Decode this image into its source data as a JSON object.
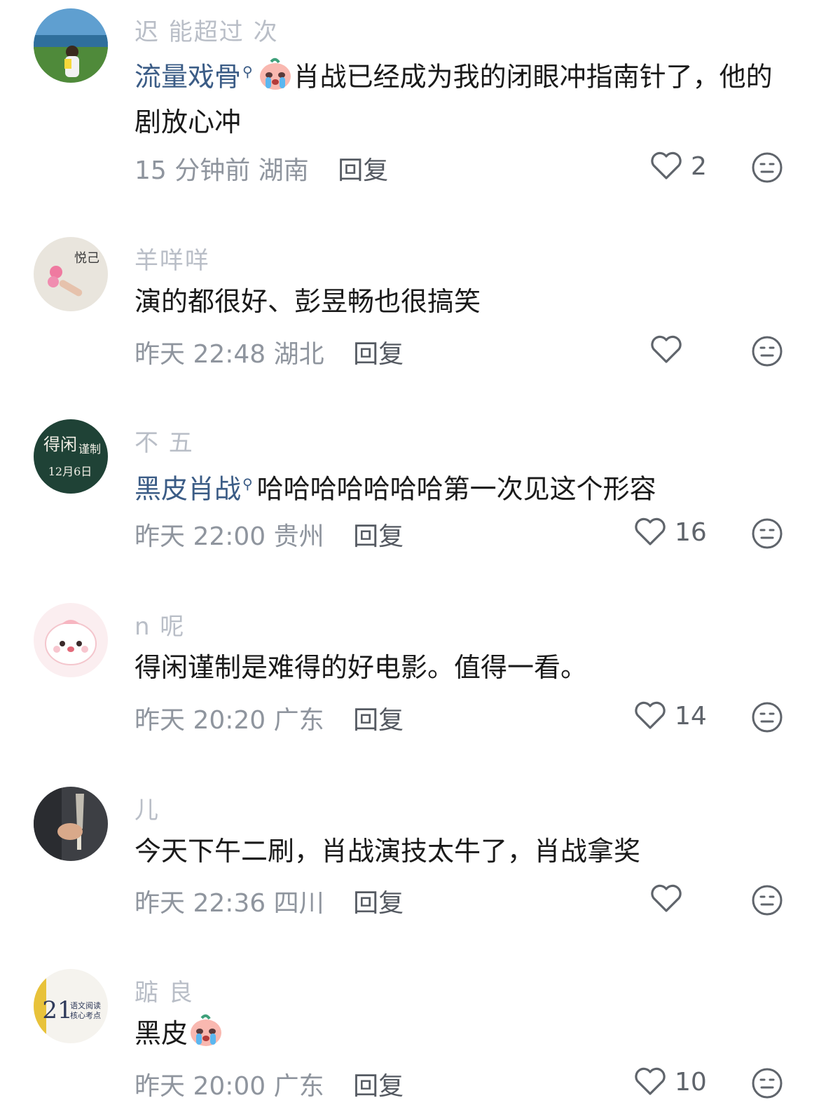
{
  "comments": [
    {
      "username": "迟 能超过 次",
      "mention": "流量戏骨",
      "text_before": "",
      "text_after": "肖战已经成为我的闭眼冲指南针了，他的剧放心冲",
      "has_emoji": true,
      "time": "15 分钟前",
      "location": "湖南",
      "reply_label": "回复",
      "likes": "2"
    },
    {
      "username": "羊咩咩",
      "mention": "",
      "text_before": "演的都很好、彭昱畅也很搞笑",
      "text_after": "",
      "has_emoji": false,
      "time": "昨天 22:48",
      "location": "湖北",
      "reply_label": "回复",
      "likes": ""
    },
    {
      "username": "不 五 ",
      "mention": "黑皮肖战",
      "text_before": "",
      "text_after": "哈哈哈哈哈哈哈第一次见这个形容",
      "has_emoji": false,
      "time": "昨天 22:00",
      "location": "贵州",
      "reply_label": "回复",
      "likes": "16"
    },
    {
      "username": "n 呢",
      "mention": "",
      "text_before": "得闲谨制是难得的好电影。值得一看。",
      "text_after": "",
      "has_emoji": false,
      "time": "昨天 20:20",
      "location": "广东",
      "reply_label": "回复",
      "likes": "14"
    },
    {
      "username": "  儿",
      "mention": "",
      "text_before": "今天下午二刷，肖战演技太牛了，肖战拿奖",
      "text_after": "",
      "has_emoji": false,
      "time": "昨天 22:36",
      "location": "四川",
      "reply_label": "回复",
      "likes": ""
    },
    {
      "username": "踮  良",
      "mention": "",
      "text_before": "黑皮",
      "text_after": "",
      "has_emoji": true,
      "time": "昨天 20:00",
      "location": "广东",
      "reply_label": "回复",
      "likes": "10"
    }
  ],
  "avatars": {
    "c3_line1": "得闲",
    "c3_line2": "谨制",
    "c3_date": "12月6日",
    "c2_sign": "悦己",
    "c6_num": "21",
    "c6_line1": "语文阅读",
    "c6_line2": "核心考点"
  },
  "colors": {
    "mention": "#3b5c86",
    "meta": "#8f959e",
    "icon": "#5f646b"
  }
}
